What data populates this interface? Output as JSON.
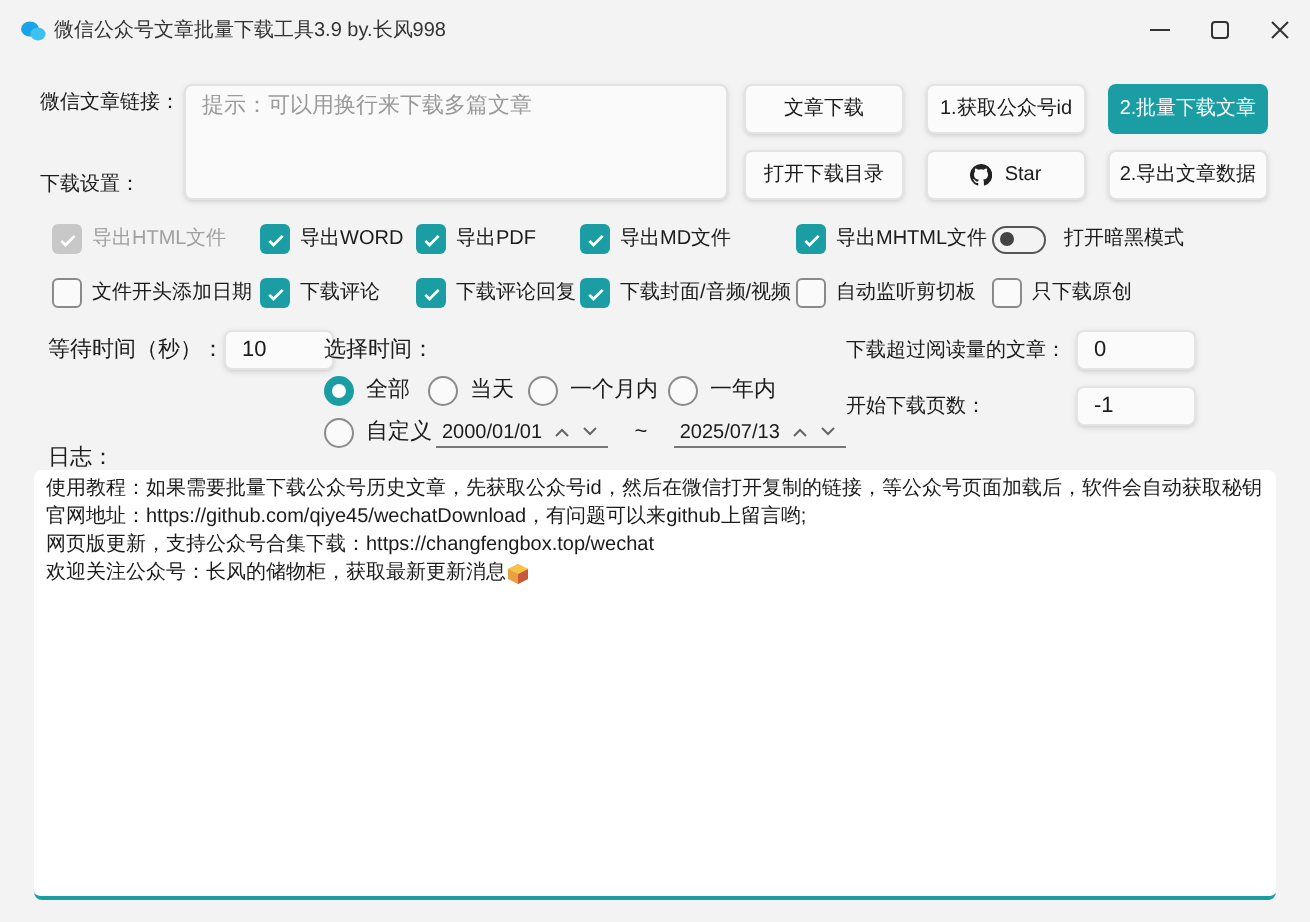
{
  "window": {
    "title": "微信公众号文章批量下载工具3.9 by.长风998"
  },
  "link_label": "微信文章链接：",
  "settings_label": "下载设置：",
  "link_field": {
    "placeholder": "提示：可以用换行来下载多篇文章"
  },
  "buttons": [
    {
      "label": "文章下载",
      "primary": false
    },
    {
      "label": "1.获取公众号id",
      "primary": false
    },
    {
      "label": "2.批量下载文章",
      "primary": true
    },
    {
      "label": "打开下载目录",
      "primary": false
    },
    {
      "label": "Star",
      "primary": false,
      "kind": "icon"
    },
    {
      "label": "2.导出文章数据",
      "primary": false
    }
  ],
  "option_rows": [
    [
      {
        "kind": "checkbox",
        "label": "导出HTML文件",
        "checked": true,
        "disabled": true
      },
      {
        "kind": "checkbox",
        "label": "导出WORD",
        "checked": true,
        "disabled": false
      },
      {
        "kind": "checkbox",
        "label": "导出PDF",
        "checked": true,
        "disabled": false
      },
      {
        "kind": "checkbox",
        "label": "导出MD文件",
        "checked": true,
        "disabled": false
      },
      {
        "kind": "checkbox",
        "label": "导出MHTML文件",
        "checked": true,
        "disabled": false
      },
      {
        "kind": "toggle",
        "label": "打开暗黑模式",
        "on": false
      }
    ],
    [
      {
        "kind": "checkbox",
        "label": "文件开头添加日期",
        "checked": false,
        "disabled": false
      },
      {
        "kind": "checkbox",
        "label": "下载评论",
        "checked": true,
        "disabled": false
      },
      {
        "kind": "checkbox",
        "label": "下载评论回复",
        "checked": true,
        "disabled": false
      },
      {
        "kind": "checkbox",
        "label": "下载封面/音频/视频",
        "checked": true,
        "disabled": false
      },
      {
        "kind": "checkbox",
        "label": "自动监听剪切板",
        "checked": false,
        "disabled": false
      },
      {
        "kind": "checkbox",
        "label": "只下载原创",
        "checked": false,
        "disabled": false
      }
    ]
  ],
  "wait": {
    "label": "等待时间（秒）：",
    "value": "10"
  },
  "time_filter": {
    "label": "选择时间：",
    "options": [
      {
        "label": "全部",
        "selected": true
      },
      {
        "label": "当天",
        "selected": false
      },
      {
        "label": "一个月内",
        "selected": false
      },
      {
        "label": "一年内",
        "selected": false
      },
      {
        "label": "自定义",
        "selected": false
      }
    ],
    "start_date": "2000/01/01",
    "separator": "~",
    "end_date": "2025/07/13"
  },
  "min_reads": {
    "label": "下载超过阅读量的文章：",
    "value": "0"
  },
  "start_page": {
    "label": "开始下载页数：",
    "value": "-1"
  },
  "log": {
    "label": "日志：",
    "lines": [
      "使用教程：如果需要批量下载公众号历史文章，先获取公众号id，然后在微信打开复制的链接，等公众号页面加载后，软件会自动获取秘钥",
      "官网地址：https://github.com/qiye45/wechatDownload，有问题可以来github上留言哟;",
      "网页版更新，支持公众号合集下载：https://changfengbox.top/wechat",
      "欢迎关注公众号：长风的储物柜，获取最新更新消息"
    ]
  }
}
